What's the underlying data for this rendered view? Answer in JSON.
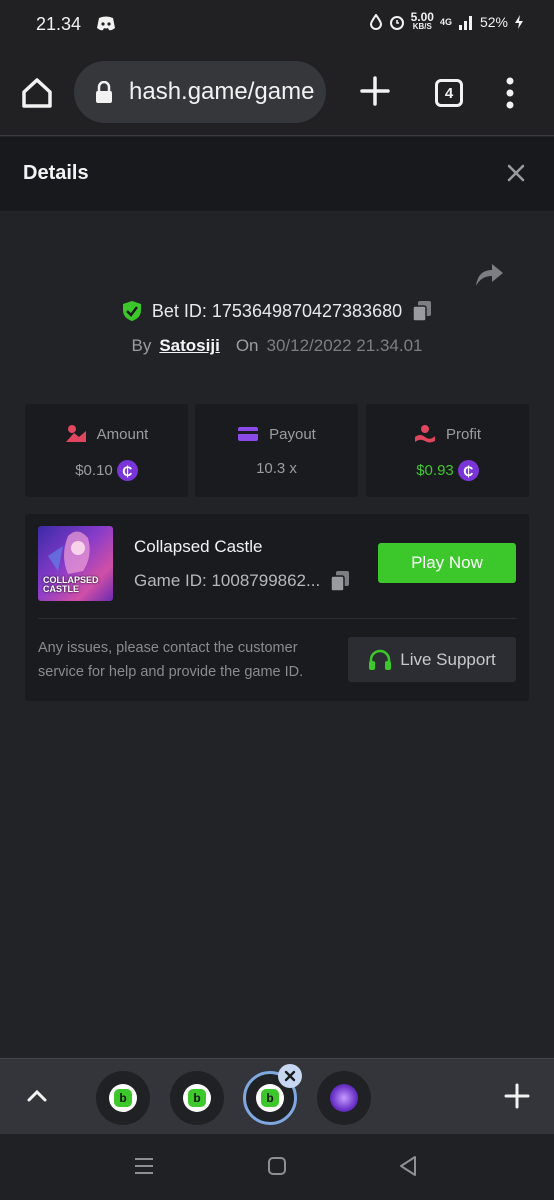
{
  "status_bar": {
    "time": "21.34",
    "net_speed": "5.00",
    "net_unit": "KB/S",
    "network": "4G",
    "battery": "52%"
  },
  "browser": {
    "url": "hash.game/game",
    "tab_count": "4"
  },
  "details": {
    "title": "Details",
    "bet_id_label": "Bet ID: 1753649870427383680",
    "by_label": "By",
    "username": "Satosiji",
    "on_label": "On",
    "date": "30/12/2022 21.34.01"
  },
  "stats": {
    "amount_label": "Amount",
    "amount_value": "$0.10",
    "payout_label": "Payout",
    "payout_value": "10.3 x",
    "profit_label": "Profit",
    "profit_value": "$0.93",
    "coin_symbol": "₵"
  },
  "game": {
    "thumb_title": "COLLAPSED CASTLE",
    "name": "Collapsed Castle",
    "game_id": "Game ID: 1008799862...",
    "play_label": "Play Now",
    "issues_text": "Any issues, please contact the customer service for help and provide the game ID.",
    "support_label": "Live Support"
  },
  "tab_strip": {
    "favicon_letter": "b"
  },
  "colors": {
    "accent_green": "#3cc82b",
    "coin_purple": "#7a35d8",
    "background": "#222327"
  }
}
